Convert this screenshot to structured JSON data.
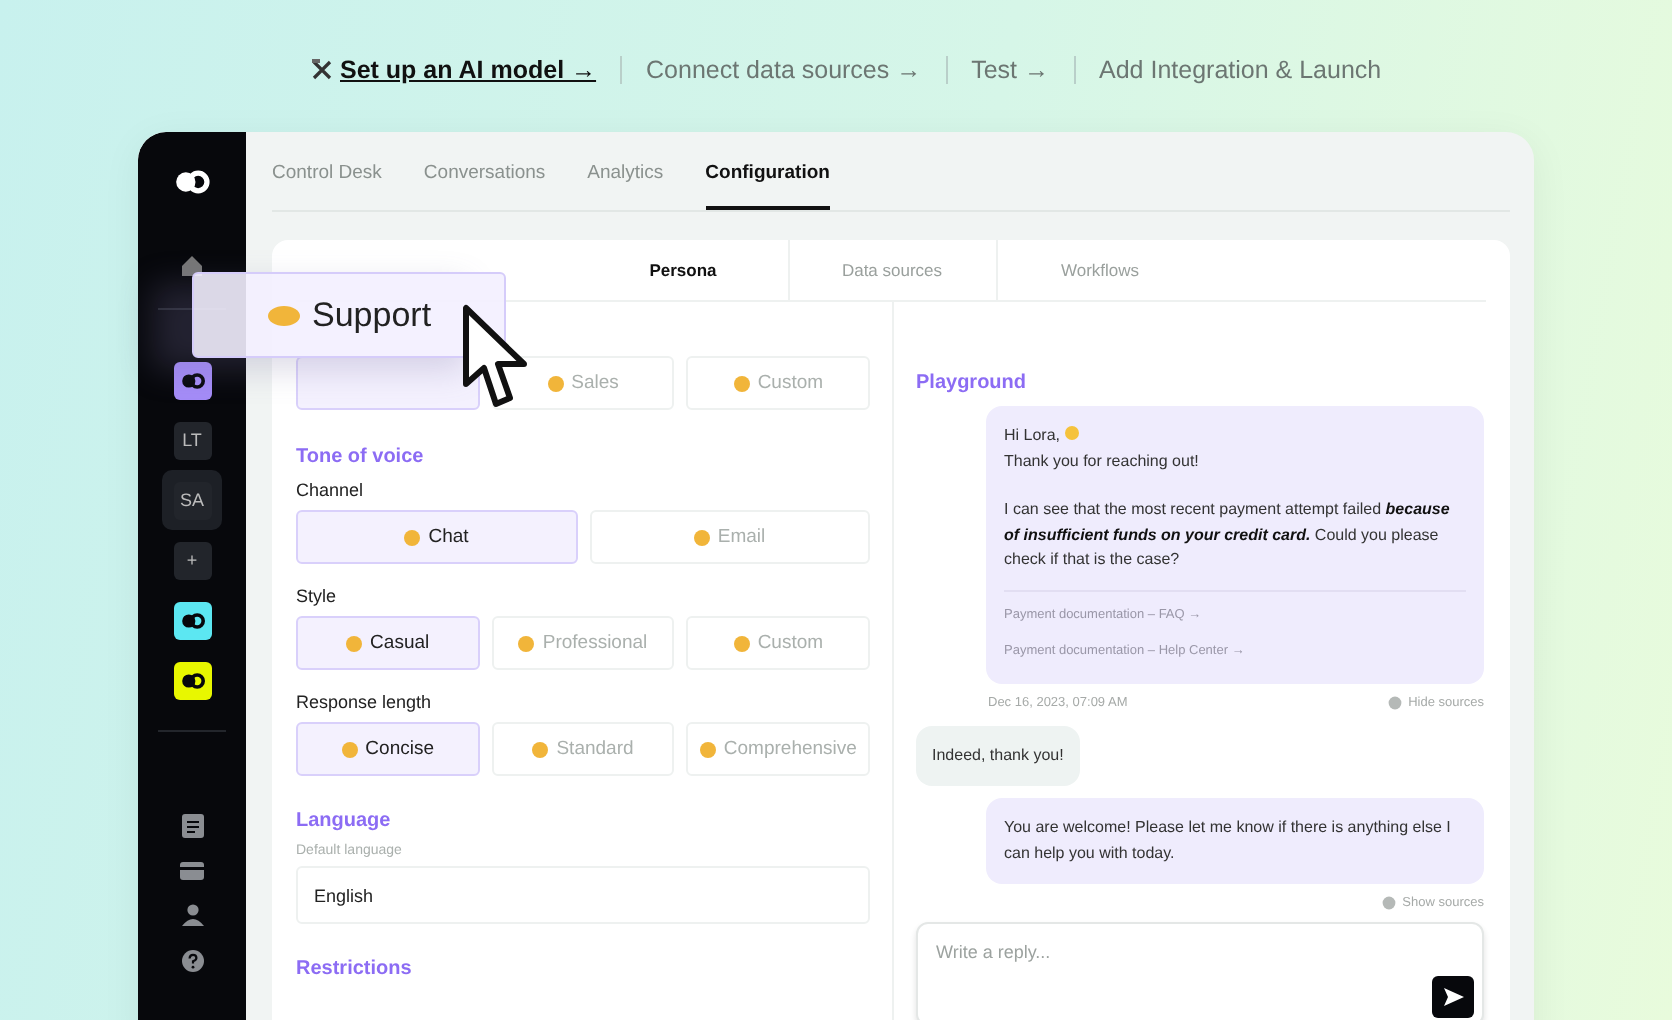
{
  "steps": [
    {
      "label": "Set up an AI model →",
      "current": true
    },
    {
      "label": "Connect data sources →",
      "current": false
    },
    {
      "label": "Test →",
      "current": false
    },
    {
      "label": "Add Integration & Launch",
      "current": false
    }
  ],
  "sidebar": {
    "workspaces": [
      {
        "kind": "logo",
        "color": "#a48cf7",
        "selected": false
      },
      {
        "kind": "initials",
        "label": "LT",
        "selected": false
      },
      {
        "kind": "initials",
        "label": "SA",
        "selected": true
      },
      {
        "kind": "add",
        "label": "+",
        "selected": false
      },
      {
        "kind": "logo",
        "color": "#5ce7f2",
        "selected": false
      },
      {
        "kind": "logo",
        "color": "#e8f700",
        "selected": false
      }
    ]
  },
  "tabs": [
    {
      "label": "Control Desk",
      "selected": false
    },
    {
      "label": "Conversations",
      "selected": false
    },
    {
      "label": "Analytics",
      "selected": false
    },
    {
      "label": "Configuration",
      "selected": true
    }
  ],
  "subtabs": [
    {
      "label": "Persona",
      "selected": true
    },
    {
      "label": "Data sources",
      "selected": false
    },
    {
      "label": "Workflows",
      "selected": false
    }
  ],
  "persona": {
    "options": [
      {
        "selected": true
      },
      {
        "label": "Sales",
        "selected": false
      },
      {
        "label": "Custom",
        "selected": false
      }
    ],
    "dragged_card": {
      "label": "Support"
    }
  },
  "tone_of_voice": {
    "heading": "Tone of voice",
    "groups": [
      {
        "label": "Channel",
        "options": [
          {
            "label": "Chat",
            "selected": true
          },
          {
            "label": "Email",
            "selected": false
          }
        ]
      },
      {
        "label": "Style",
        "options": [
          {
            "label": "Casual",
            "selected": true
          },
          {
            "label": "Professional",
            "selected": false
          },
          {
            "label": "Custom",
            "selected": false
          }
        ]
      },
      {
        "label": "Response length",
        "options": [
          {
            "label": "Concise",
            "selected": true
          },
          {
            "label": "Standard",
            "selected": false
          },
          {
            "label": "Comprehensive",
            "selected": false
          }
        ]
      }
    ]
  },
  "language": {
    "heading": "Language",
    "field_label": "Default language",
    "value": "English"
  },
  "restrictions": {
    "heading": "Restrictions"
  },
  "playground": {
    "heading": "Playground",
    "messages": [
      {
        "kind": "bot",
        "lines": [
          "Hi Lora,",
          "Thank you for reaching out!",
          "I can see that the most recent payment attempt failed **because of insufficient funds on your credit card.** Could you please check if that is the case?"
        ],
        "sources": [
          "Payment documentation – FAQ →",
          "Payment documentation – Help Center →"
        ],
        "time": "Dec 16, 2023, 07:09 AM",
        "toggle": "Hide sources"
      },
      {
        "kind": "user",
        "lines": [
          "Indeed, thank you!"
        ]
      },
      {
        "kind": "bot",
        "lines": [
          "You are welcome! Please let me know if there is anything else I can help you with today."
        ],
        "toggle": "Show sources"
      }
    ],
    "reply": {
      "placeholder": "Write a reply..."
    }
  }
}
